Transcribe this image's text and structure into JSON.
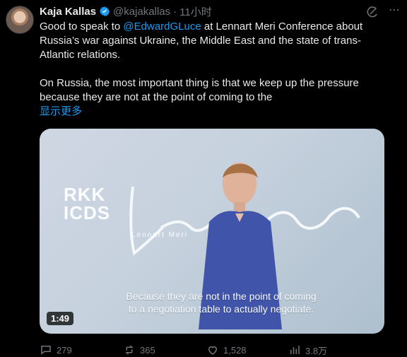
{
  "tweet": {
    "author_name": "Kaja Kallas",
    "author_handle": "@kajakallas",
    "separator": "·",
    "time": "11小时",
    "text_lines": [
      "Good to speak to ",
      "@EdwardGLuce",
      " at Lennart Meri Conference about",
      "Russia’s war against Ukraine, the Middle East and the state of trans-",
      "Atlantic relations.",
      "On Russia, the most important thing is that we keep up the pressure",
      "because they are not at the point of coming to the"
    ],
    "show_more": "显示更多"
  },
  "media": {
    "brand_lines": [
      "RKK",
      "ICDS"
    ],
    "event_text": "Lennart Meri",
    "subtitle_lines": [
      "Because they are not in the point of coming",
      "to a negotiation table to actually negotiate."
    ],
    "duration": "1:49"
  },
  "actions": {
    "replies": "279",
    "reposts": "365",
    "likes": "1,528",
    "views": "3.8万"
  },
  "icons": {
    "verified": "verified-badge-icon",
    "grok": "grok-icon",
    "more": "more-icon",
    "reply": "reply-icon",
    "repost": "repost-icon",
    "like": "like-icon",
    "views": "views-icon"
  }
}
